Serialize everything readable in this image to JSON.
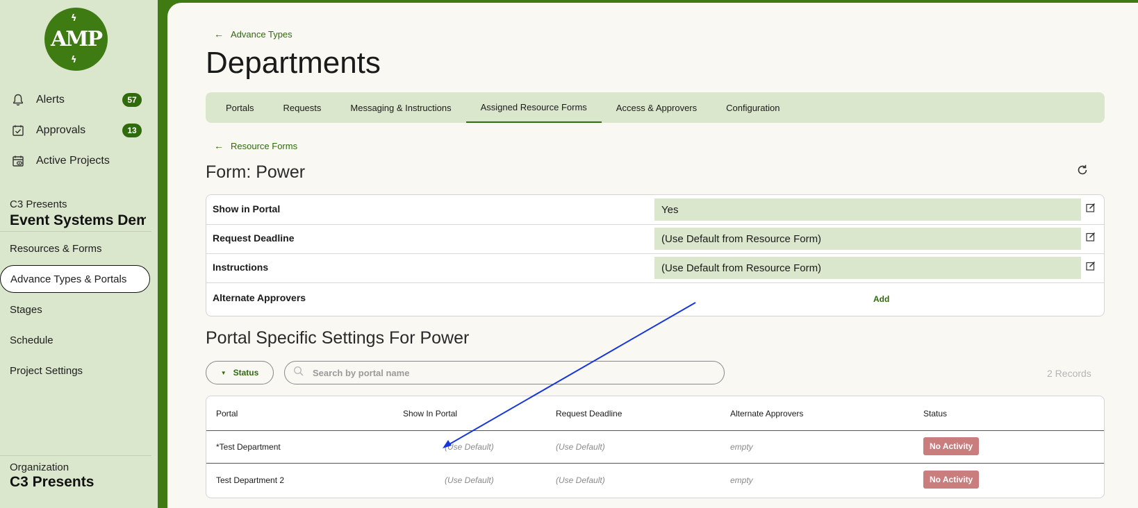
{
  "sidebar": {
    "logo_text": "AMP",
    "nav": [
      {
        "label": "Alerts",
        "icon": "bell-icon",
        "badge": "57"
      },
      {
        "label": "Approvals",
        "icon": "calendar-check-icon",
        "badge": "13"
      },
      {
        "label": "Active Projects",
        "icon": "calendar-eye-icon"
      }
    ],
    "project_label": "C3 Presents",
    "project_name": "Event Systems Demo",
    "links": [
      "Resources & Forms",
      "Advance Types & Portals",
      "Stages",
      "Schedule",
      "Project Settings"
    ],
    "active_link": "Advance Types & Portals",
    "org_label": "Organization",
    "org_name": "C3 Presents",
    "accent_color": "#2f6a0c",
    "background_color": "#dbe7cd"
  },
  "header": {
    "back_link": "Advance Types",
    "title": "Departments"
  },
  "tabs": [
    "Portals",
    "Requests",
    "Messaging & Instructions",
    "Assigned Resource Forms",
    "Access & Approvers",
    "Configuration"
  ],
  "active_tab": "Assigned Resource Forms",
  "form": {
    "back_link": "Resource Forms",
    "title": "Form: Power",
    "settings": [
      {
        "label": "Show in Portal",
        "value": "Yes"
      },
      {
        "label": "Request Deadline",
        "value": "(Use Default from Resource Form)"
      },
      {
        "label": "Instructions",
        "value": "(Use Default from Resource Form)"
      },
      {
        "label": "Alternate Approvers",
        "action": "Add"
      }
    ]
  },
  "portal_section": {
    "title": "Portal Specific Settings For Power",
    "status_filter": "Status",
    "search_placeholder": "Search by portal name",
    "records": "2 Records",
    "columns": [
      "Portal",
      "Show In Portal",
      "Request Deadline",
      "Alternate Approvers",
      "Status"
    ],
    "rows": [
      {
        "portal": "*Test Department",
        "show": "(Use Default)",
        "deadline": "(Use Default)",
        "approvers": "empty",
        "status": "No Activity"
      },
      {
        "portal": "Test Department 2",
        "show": "(Use Default)",
        "deadline": "(Use Default)",
        "approvers": "empty",
        "status": "No Activity"
      }
    ],
    "status_color": "#c97d7d"
  }
}
